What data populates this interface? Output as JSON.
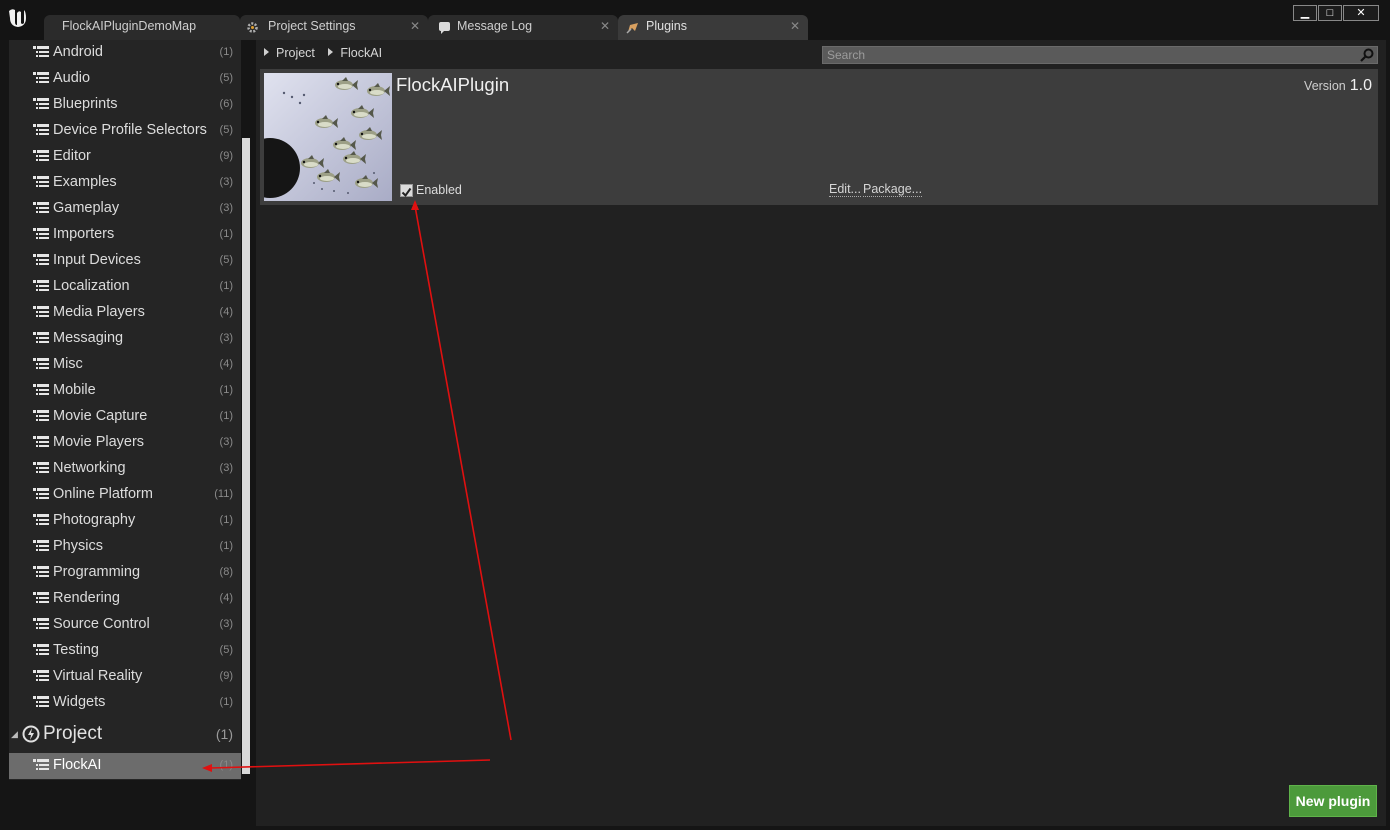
{
  "tabs": [
    {
      "label": "FlockAIPluginDemoMap"
    },
    {
      "label": "Project Settings"
    },
    {
      "label": "Message Log"
    },
    {
      "label": "Plugins"
    }
  ],
  "window_controls": {
    "minimize": "▁",
    "maximize": "□",
    "close": "✕"
  },
  "sidebar": {
    "categories": [
      {
        "label": "Android",
        "count": "(1)"
      },
      {
        "label": "Audio",
        "count": "(5)"
      },
      {
        "label": "Blueprints",
        "count": "(6)"
      },
      {
        "label": "Device Profile Selectors",
        "count": "(5)"
      },
      {
        "label": "Editor",
        "count": "(9)"
      },
      {
        "label": "Examples",
        "count": "(3)"
      },
      {
        "label": "Gameplay",
        "count": "(3)"
      },
      {
        "label": "Importers",
        "count": "(1)"
      },
      {
        "label": "Input Devices",
        "count": "(5)"
      },
      {
        "label": "Localization",
        "count": "(1)"
      },
      {
        "label": "Media Players",
        "count": "(4)"
      },
      {
        "label": "Messaging",
        "count": "(3)"
      },
      {
        "label": "Misc",
        "count": "(4)"
      },
      {
        "label": "Mobile",
        "count": "(1)"
      },
      {
        "label": "Movie Capture",
        "count": "(1)"
      },
      {
        "label": "Movie Players",
        "count": "(3)"
      },
      {
        "label": "Networking",
        "count": "(3)"
      },
      {
        "label": "Online Platform",
        "count": "(11)"
      },
      {
        "label": "Photography",
        "count": "(1)"
      },
      {
        "label": "Physics",
        "count": "(1)"
      },
      {
        "label": "Programming",
        "count": "(8)"
      },
      {
        "label": "Rendering",
        "count": "(4)"
      },
      {
        "label": "Source Control",
        "count": "(3)"
      },
      {
        "label": "Testing",
        "count": "(5)"
      },
      {
        "label": "Virtual Reality",
        "count": "(9)"
      },
      {
        "label": "Widgets",
        "count": "(1)"
      }
    ],
    "project": {
      "label": "Project",
      "count": "(1)"
    },
    "project_item": {
      "label": "FlockAI",
      "count": "(1)"
    }
  },
  "breadcrumb": {
    "root": "Project",
    "current": "FlockAI"
  },
  "search": {
    "placeholder": "Search",
    "value": ""
  },
  "plugin": {
    "name": "FlockAIPlugin",
    "version_label": "Version",
    "version": "1.0",
    "enabled_label": "Enabled",
    "enabled": true,
    "edit_label": "Edit...",
    "package_label": "Package..."
  },
  "new_plugin_label": "New plugin",
  "colors": {
    "accent_green": "#4c9a3b",
    "annotation_red": "#e01010",
    "selected_row": "#6c6c6c"
  },
  "icons": [
    "unreal-logo-icon",
    "list-tree-icon",
    "project-icon",
    "search-icon",
    "checkbox-icon",
    "plugin-icon",
    "message-log-icon",
    "settings-icon",
    "close-icon"
  ]
}
